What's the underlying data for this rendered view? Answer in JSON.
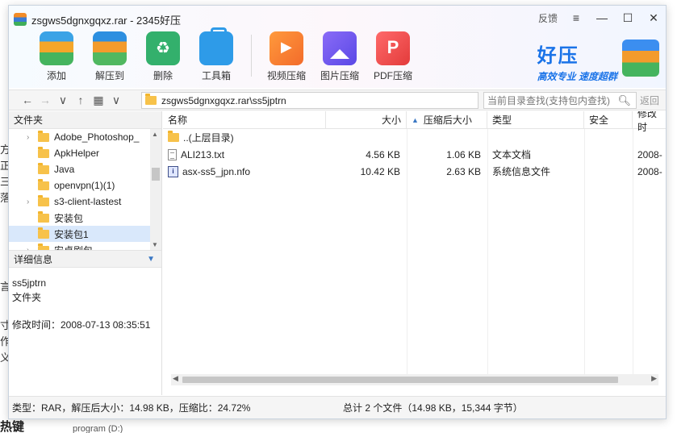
{
  "background": {
    "left_chars": [
      "方",
      "正",
      "三",
      "落"
    ],
    "left_chars_lower": [
      "言",
      "",
      "",
      "寸",
      "作",
      "义"
    ],
    "hotkey_label": "热键",
    "program_text": "program (D:)"
  },
  "window": {
    "title": "zsgws5dgnxgqxz.rar - 2345好压",
    "controls": {
      "feedback": "反馈",
      "menu": "≡",
      "minimize": "—",
      "maximize": "☐",
      "close": "✕"
    }
  },
  "toolbar": {
    "items": [
      {
        "label": "添加",
        "icon": "add-archive-icon"
      },
      {
        "label": "解压到",
        "icon": "extract-icon"
      },
      {
        "label": "删除",
        "icon": "delete-icon"
      },
      {
        "label": "工具箱",
        "icon": "toolbox-icon"
      },
      {
        "label": "视频压缩",
        "icon": "video-compress-icon"
      },
      {
        "label": "图片压缩",
        "icon": "image-compress-icon"
      },
      {
        "label": "PDF压缩",
        "icon": "pdf-compress-icon"
      }
    ]
  },
  "brand": {
    "name": "好压",
    "slogan": "高效专业 速度超群"
  },
  "address": {
    "path": "zsgws5dgnxgqxz.rar\\ss5jptrn",
    "search_placeholder": "当前目录查找(支持包内查找)",
    "back_label": "返回"
  },
  "left_pane": {
    "header": "文件夹",
    "tree": [
      {
        "label": "Adobe_Photoshop_",
        "expandable": true
      },
      {
        "label": "ApkHelper",
        "expandable": false
      },
      {
        "label": "Java",
        "expandable": false
      },
      {
        "label": "openvpn(1)(1)",
        "expandable": false
      },
      {
        "label": "s3-client-lastest",
        "expandable": true
      },
      {
        "label": "安装包",
        "expandable": false
      },
      {
        "label": "安装包1",
        "expandable": false,
        "selected": true
      },
      {
        "label": "安卓刷包",
        "expandable": true
      }
    ],
    "detail_header": "详细信息",
    "detail": {
      "name": "ss5jptrn",
      "type": "文件夹",
      "modified": "修改时间：2008-07-13 08:35:51"
    }
  },
  "file_list": {
    "columns": {
      "name": "名称",
      "size": "大小",
      "compressed": "压缩后大小",
      "compressed_sort": "▲",
      "type": "类型",
      "security": "安全",
      "modified": "修改时"
    },
    "rows": [
      {
        "icon": "folder-icon",
        "name": "..(上层目录)",
        "size": "",
        "compressed": "",
        "type": "",
        "modified": ""
      },
      {
        "icon": "text-file-icon",
        "name": "ALI213.txt",
        "size": "4.56 KB",
        "compressed": "1.06 KB",
        "type": "文本文档",
        "modified": "2008-"
      },
      {
        "icon": "nfo-file-icon",
        "name": "asx-ss5_jpn.nfo",
        "size": "10.42 KB",
        "compressed": "2.63 KB",
        "type": "系统信息文件",
        "modified": "2008-"
      }
    ]
  },
  "status": {
    "left": "类型：RAR，解压后大小：14.98 KB，压缩比：24.72%",
    "right": "总计 2 个文件（14.98 KB，15,344 字节）"
  }
}
